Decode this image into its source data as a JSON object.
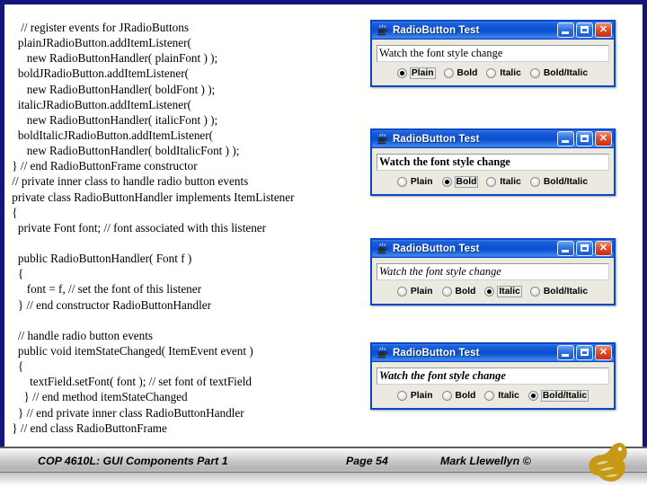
{
  "slide": {
    "background_color": "#ffffff",
    "border_color": "#16167a",
    "code_lines": [
      "    // register events for JRadioButtons",
      "   plainJRadioButton.addItemListener(",
      "      new RadioButtonHandler( plainFont ) );",
      "   boldJRadioButton.addItemListener(",
      "      new RadioButtonHandler( boldFont ) );",
      "   italicJRadioButton.addItemListener(",
      "      new RadioButtonHandler( italicFont ) );",
      "   boldItalicJRadioButton.addItemListener(",
      "      new RadioButtonHandler( boldItalicFont ) );",
      " } // end RadioButtonFrame constructor",
      " // private inner class to handle radio button events",
      " private class RadioButtonHandler implements ItemListener",
      " {",
      "   private Font font; // font associated with this listener",
      "",
      "   public RadioButtonHandler( Font f )",
      "   {",
      "      font = f, // set the font of this listener",
      "   } // end constructor RadioButtonHandler",
      "",
      "   // handle radio button events",
      "   public void itemStateChanged( ItemEvent event )",
      "   {",
      "       textField.setFont( font ); // set font of textField",
      "     } // end method itemStateChanged",
      "   } // end private inner class RadioButtonHandler",
      " } // end class RadioButtonFrame"
    ]
  },
  "windows": [
    {
      "title": "RadioButton Test",
      "icon": "java-cup-icon",
      "minimize_label": "Minimize",
      "maximize_label": "Maximize",
      "close_label": "Close",
      "textfield_value": "Watch the font style change",
      "textfield_style": "plain",
      "radios": [
        {
          "label": "Plain",
          "selected": true
        },
        {
          "label": "Bold",
          "selected": false
        },
        {
          "label": "Italic",
          "selected": false
        },
        {
          "label": "Bold/Italic",
          "selected": false
        }
      ]
    },
    {
      "title": "RadioButton Test",
      "icon": "java-cup-icon",
      "minimize_label": "Minimize",
      "maximize_label": "Maximize",
      "close_label": "Close",
      "textfield_value": "Watch the font style change",
      "textfield_style": "bold",
      "radios": [
        {
          "label": "Plain",
          "selected": false
        },
        {
          "label": "Bold",
          "selected": true
        },
        {
          "label": "Italic",
          "selected": false
        },
        {
          "label": "Bold/Italic",
          "selected": false
        }
      ]
    },
    {
      "title": "RadioButton Test",
      "icon": "java-cup-icon",
      "minimize_label": "Minimize",
      "maximize_label": "Maximize",
      "close_label": "Close",
      "textfield_value": "Watch the font style change",
      "textfield_style": "italic",
      "radios": [
        {
          "label": "Plain",
          "selected": false
        },
        {
          "label": "Bold",
          "selected": false
        },
        {
          "label": "Italic",
          "selected": true
        },
        {
          "label": "Bold/Italic",
          "selected": false
        }
      ]
    },
    {
      "title": "RadioButton Test",
      "icon": "java-cup-icon",
      "minimize_label": "Minimize",
      "maximize_label": "Maximize",
      "close_label": "Close",
      "textfield_value": "Watch the font style change",
      "textfield_style": "bold-italic",
      "radios": [
        {
          "label": "Plain",
          "selected": false
        },
        {
          "label": "Bold",
          "selected": false
        },
        {
          "label": "Italic",
          "selected": false
        },
        {
          "label": "Bold/Italic",
          "selected": true
        }
      ]
    }
  ],
  "footer": {
    "course": "COP 4610L: GUI Components Part 1",
    "page": "Page 54",
    "author": "Mark Llewellyn ©",
    "logo": "ucf-pegasus-logo",
    "logo_color": "#c79a16"
  }
}
